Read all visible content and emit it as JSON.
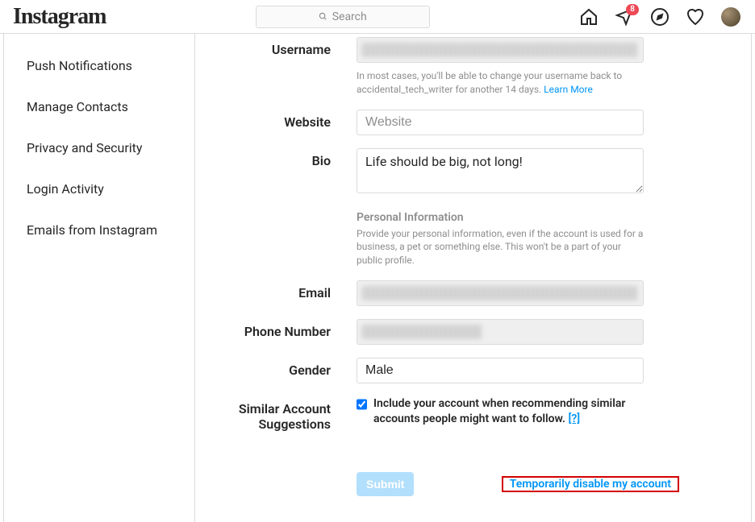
{
  "header": {
    "logo_text": "Instagram",
    "search_placeholder": "Search",
    "badge_count": "8"
  },
  "sidebar": {
    "items": [
      {
        "label": "Push Notifications"
      },
      {
        "label": "Manage Contacts"
      },
      {
        "label": "Privacy and Security"
      },
      {
        "label": "Login Activity"
      },
      {
        "label": "Emails from Instagram"
      }
    ]
  },
  "form": {
    "username": {
      "label": "Username",
      "help_prefix": "In most cases, you'll be able to change your username back to accidental_tech_writer for another 14 days. ",
      "learn_more": "Learn More"
    },
    "website": {
      "label": "Website",
      "placeholder": "Website",
      "value": ""
    },
    "bio": {
      "label": "Bio",
      "value": "Life should be big, not long!"
    },
    "personal_info": {
      "heading": "Personal Information",
      "description": "Provide your personal information, even if the account is used for a business, a pet or something else. This won't be a part of your public profile."
    },
    "email": {
      "label": "Email"
    },
    "phone": {
      "label": "Phone Number"
    },
    "gender": {
      "label": "Gender",
      "value": "Male"
    },
    "similar": {
      "label_line1": "Similar Account",
      "label_line2": "Suggestions",
      "checkbox_text": "Include your account when recommending similar accounts people might want to follow.  ",
      "qmark": "[?]",
      "checked": true
    },
    "actions": {
      "submit": "Submit",
      "disable_link": "Temporarily disable my account"
    }
  }
}
